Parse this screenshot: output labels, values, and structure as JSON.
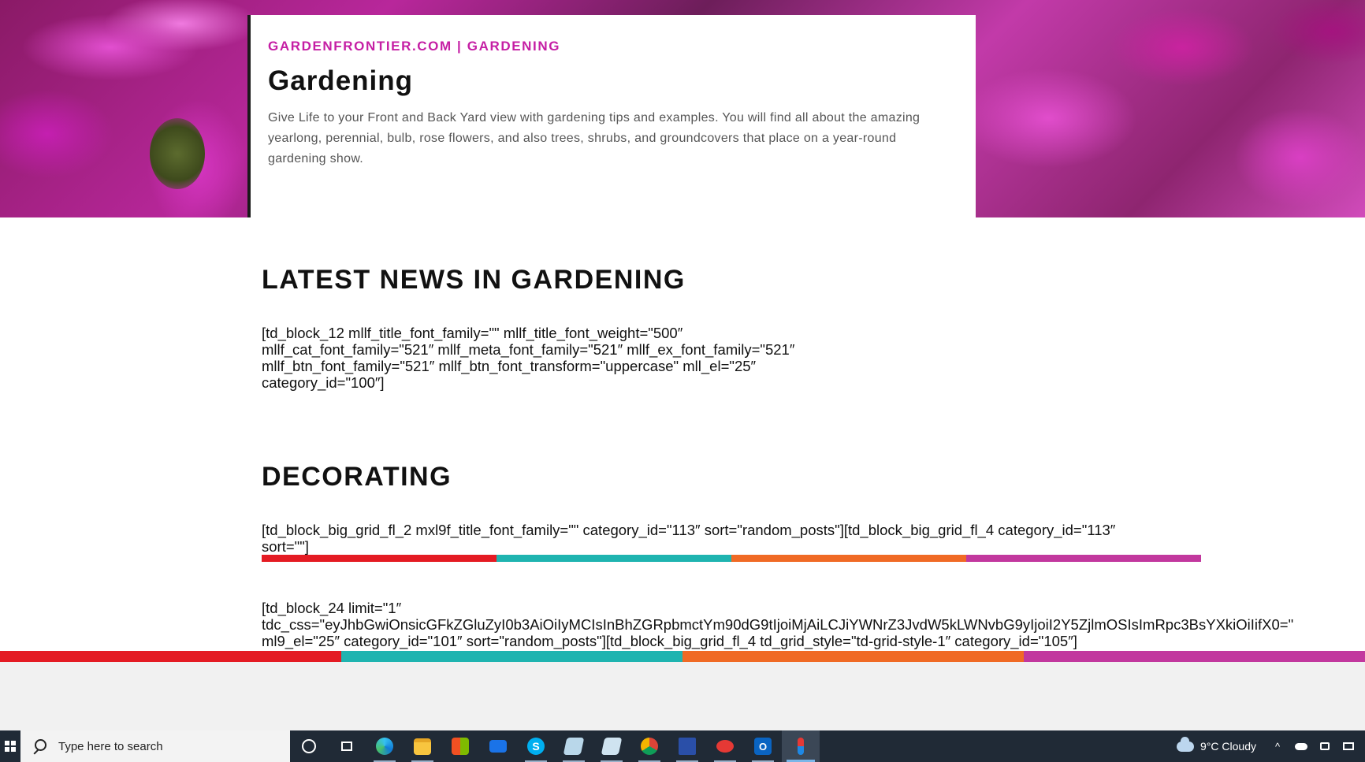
{
  "hero": {
    "kicker": "GARDENFRONTIER.COM | GARDENING",
    "title": "Gardening",
    "description": "Give Life to your Front and Back Yard view with gardening tips and examples. You will find all about the amazing yearlong, perennial, bulb, rose flowers, and also trees, shrubs, and groundcovers that place on a year-round gardening show."
  },
  "sections": [
    {
      "heading": "LATEST NEWS IN GARDENING",
      "shortcode": "[td_block_12 mllf_title_font_family=\"\" mllf_title_font_weight=\"500″\nmllf_cat_font_family=\"521″ mllf_meta_font_family=\"521″ mllf_ex_font_family=\"521″\nmllf_btn_font_family=\"521″ mllf_btn_font_transform=\"uppercase\" mll_el=\"25″\ncategory_id=\"100″]"
    },
    {
      "heading": "DECORATING",
      "shortcode": "[td_block_big_grid_fl_2 mxl9f_title_font_family=\"\" category_id=\"113″ sort=\"random_posts\"][td_block_big_grid_fl_4 category_id=\"113″\nsort=\"\"]",
      "shortcode2": "[td_block_24 limit=\"1″\ntdc_css=\"eyJhbGwiOnsicGFkZGluZyI0b3AiOiIyMCIsInBhZGRpbmctYm90dG9tIjoiMjAiLCJiYWNrZ3JvdW5kLWNvbG9yIjoiI2Y5ZjlmOSIsImRpc3BsYXkiOiIifX0=\"\nml9_el=\"25″ category_id=\"101″ sort=\"random_posts\"][td_block_big_grid_fl_4 td_grid_style=\"td-grid-style-1″ category_id=\"105″]"
    }
  ],
  "colors": {
    "accent": "#c51ea4",
    "stripe": [
      "#e41b23",
      "#1fb4b0",
      "#f06a25",
      "#c2389e"
    ],
    "taskbar": "#202a36"
  },
  "taskbar": {
    "search_placeholder": "Type here to search",
    "apps": [
      "cortana-icon",
      "task-view-icon",
      "edge-icon",
      "file-explorer-icon",
      "store-icon",
      "mail-icon",
      "skype-icon",
      "notepad-icon",
      "notepad2-icon",
      "chrome-icon",
      "floppy-icon",
      "app-red-icon",
      "outlook-icon",
      "app-active-icon"
    ],
    "weather": "9°C  Cloudy"
  }
}
